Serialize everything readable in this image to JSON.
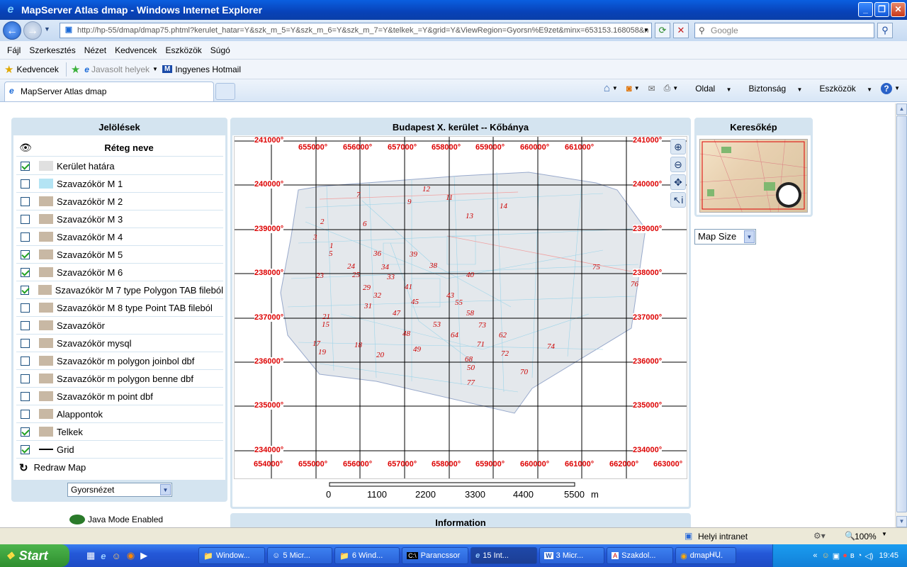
{
  "window": {
    "title": "MapServer Atlas dmap - Windows Internet Explorer"
  },
  "address": {
    "url": "http://hp-55/dmap/dmap75.phtml?kerulet_hatar=Y&szk_m_5=Y&szk_m_6=Y&szk_m_7=Y&telkek_=Y&grid=Y&ViewRegion=Gyorsn%E9zet&minx=653153.168058&n",
    "search_placeholder": "Google"
  },
  "menu": [
    "Fájl",
    "Szerkesztés",
    "Nézet",
    "Kedvencek",
    "Eszközök",
    "Súgó"
  ],
  "favorites": {
    "kedvencek": "Kedvencek",
    "javasolt": "Javasolt helyek",
    "hotmail": "Ingyenes Hotmail"
  },
  "tab": {
    "title": "MapServer Atlas dmap"
  },
  "commandbar": {
    "oldal": "Oldal",
    "biztonsag": "Biztonság",
    "eszkozok": "Eszközök"
  },
  "legend": {
    "title": "Jelölések",
    "column_header": "Réteg neve",
    "layers": [
      {
        "name": "Kerület határa",
        "checked": true,
        "swatch": "#e0e0e0"
      },
      {
        "name": "Szavazókör M 1",
        "checked": false,
        "swatch": "#b4e4f4"
      },
      {
        "name": "Szavazókör M 2",
        "checked": false,
        "swatch": "#c8b8a4"
      },
      {
        "name": "Szavazókör M 3",
        "checked": false,
        "swatch": "#c8b8a4"
      },
      {
        "name": "Szavazókör M 4",
        "checked": false,
        "swatch": "#c8b8a4"
      },
      {
        "name": "Szavazókör M 5",
        "checked": true,
        "swatch": "#c8b8a4"
      },
      {
        "name": "Szavazókör M 6",
        "checked": true,
        "swatch": "#c8b8a4"
      },
      {
        "name": "Szavazókör M 7 type Polygon TAB fileból",
        "checked": true,
        "swatch": "#c8b8a4"
      },
      {
        "name": "Szavazókör M 8 type Point TAB fileból",
        "checked": false,
        "swatch": "#c8b8a4"
      },
      {
        "name": "Szavazókör",
        "checked": false,
        "swatch": "#c8b8a4"
      },
      {
        "name": "Szavazókör mysql",
        "checked": false,
        "swatch": "#c8b8a4"
      },
      {
        "name": "Szavazókör m polygon joinbol dbf",
        "checked": false,
        "swatch": "#c8b8a4"
      },
      {
        "name": "Szavazókör m polygon benne dbf",
        "checked": false,
        "swatch": "#c8b8a4"
      },
      {
        "name": "Szavazókör m point dbf",
        "checked": false,
        "swatch": "#c8b8a4"
      },
      {
        "name": "Alappontok",
        "checked": false,
        "swatch": "#c8b8a4"
      },
      {
        "name": "Telkek",
        "checked": true,
        "swatch": "#c8b8a4"
      },
      {
        "name": "Grid",
        "checked": true,
        "swatch": "line"
      }
    ],
    "redraw": "Redraw Map",
    "view_select": "Gyorsnézet",
    "java_mode": "Java Mode Enabled"
  },
  "map": {
    "title": "Budapest X. kerület -- Kőbánya",
    "y_labels": [
      "241000°",
      "240000°",
      "239000°",
      "238000°",
      "237000°",
      "236000°",
      "235000°",
      "234000°"
    ],
    "x_top_labels": [
      "655000°",
      "656000°",
      "657000°",
      "658000°",
      "659000°",
      "660000°",
      "661000°"
    ],
    "x_bottom_labels": [
      "654000°",
      "655000°",
      "656000°",
      "657000°",
      "658000°",
      "659000°",
      "660000°",
      "661000°",
      "662000°",
      "663000°"
    ],
    "district_numbers": [
      "7",
      "12",
      "9",
      "11",
      "14",
      "13",
      "2",
      "6",
      "3",
      "1",
      "5",
      "36",
      "39",
      "38",
      "24",
      "34",
      "25",
      "33",
      "23",
      "40",
      "75",
      "76",
      "29",
      "32",
      "41",
      "43",
      "31",
      "45",
      "55",
      "47",
      "58",
      "21",
      "15",
      "53",
      "73",
      "48",
      "64",
      "62",
      "17",
      "18",
      "71",
      "49",
      "19",
      "72",
      "20",
      "74",
      "68",
      "50",
      "70",
      "77"
    ],
    "scale_labels": [
      "0",
      "1100",
      "2200",
      "3300",
      "4400",
      "5500"
    ],
    "scale_unit": "m",
    "info_title": "Information"
  },
  "keymap": {
    "title": "Keresőkép",
    "map_size": "Map Size"
  },
  "status": {
    "zone": "Helyi intranet",
    "zoom": "100%"
  },
  "taskbar": {
    "start": "Start",
    "items": [
      "Window...",
      "5 Micr...",
      "6 Wind...",
      "Parancssor",
      "15 Int...",
      "3 Micr...",
      "Szakdol...",
      "dmap - ..."
    ],
    "lang": "HU",
    "clock": "19:45"
  }
}
